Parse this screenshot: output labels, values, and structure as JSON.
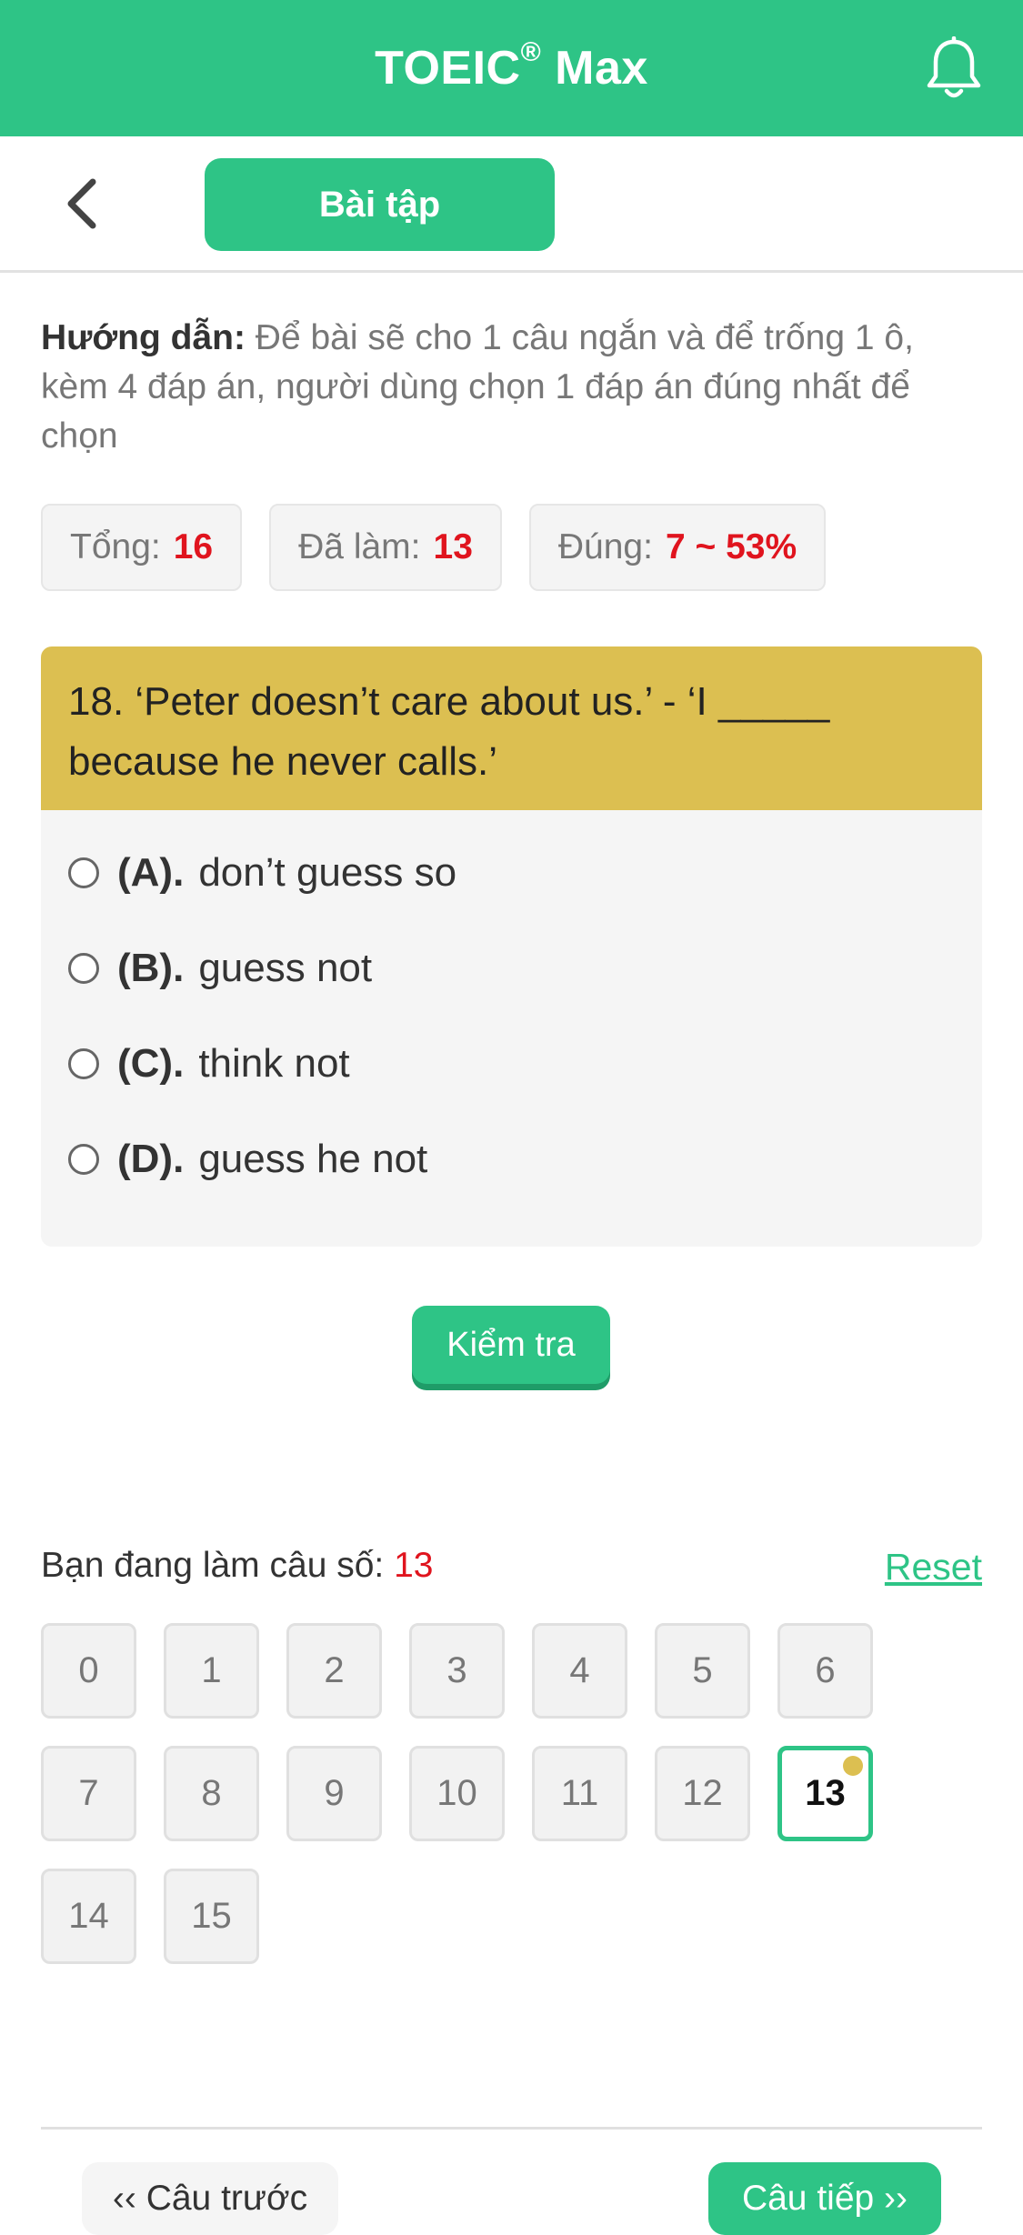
{
  "header": {
    "title": "TOEIC",
    "title_mark": "®",
    "title_suffix": " Max",
    "bell_icon": "bell-icon"
  },
  "subheader": {
    "back_icon": "chevron-left-icon",
    "tab_label": "Bài tập"
  },
  "instructions": {
    "label": "Hướng dẫn:",
    "text": " Để bài sẽ cho 1 câu ngắn và để trống 1 ô, kèm 4 đáp án, người dùng chọn 1 đáp án đúng nhất để chọn"
  },
  "stats": {
    "total_label": "Tổng:",
    "total_value": "16",
    "done_label": "Đã làm:",
    "done_value": "13",
    "correct_label": "Đúng:",
    "correct_value": "7 ~ 53%"
  },
  "question": {
    "text": "18. ‘Peter doesn’t care about us.’ - ‘I _____ because he never calls.’",
    "options": [
      {
        "letter": "(A).",
        "text": "don’t guess so"
      },
      {
        "letter": "(B).",
        "text": "guess not"
      },
      {
        "letter": "(C).",
        "text": "think not"
      },
      {
        "letter": "(D).",
        "text": "guess he not"
      }
    ]
  },
  "check_button": "Kiểm tra",
  "progress": {
    "label": "Bạn đang làm câu số:",
    "current": "13",
    "reset": "Reset",
    "numbers": [
      "0",
      "1",
      "2",
      "3",
      "4",
      "5",
      "6",
      "7",
      "8",
      "9",
      "10",
      "11",
      "12",
      "13",
      "14",
      "15"
    ]
  },
  "footer": {
    "prev": "‹‹ Câu trước",
    "next": "Câu tiếp ››"
  },
  "colors": {
    "brand": "#2ec486",
    "question_bg": "#dcbf51",
    "highlight": "#e0141e"
  }
}
